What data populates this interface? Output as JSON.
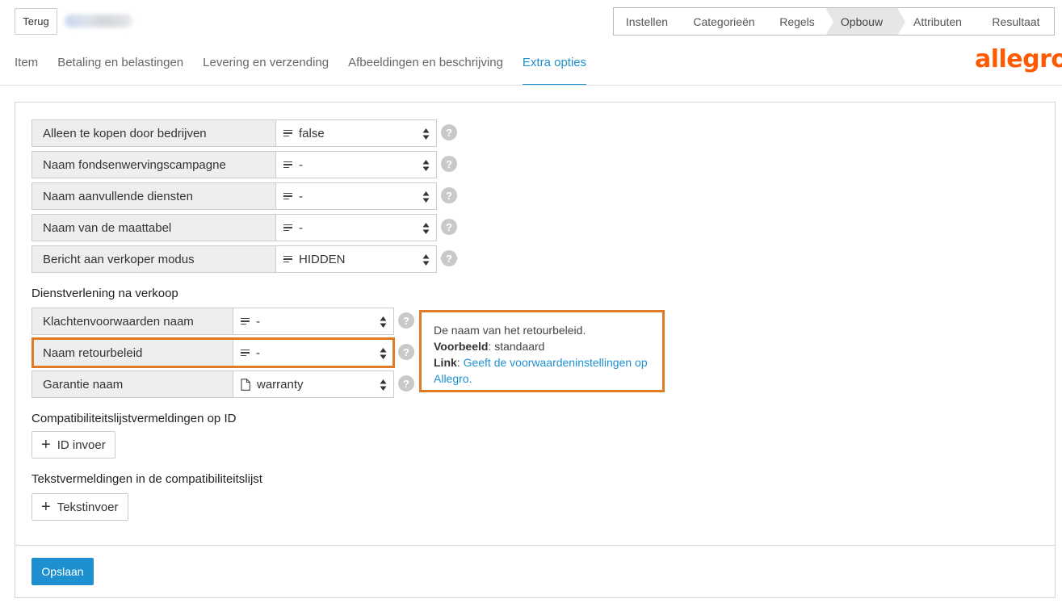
{
  "header": {
    "back_label": "Terug"
  },
  "steps": [
    {
      "label": "Instellen"
    },
    {
      "label": "Categorieën"
    },
    {
      "label": "Regels"
    },
    {
      "label": "Opbouw"
    },
    {
      "label": "Attributen"
    },
    {
      "label": "Resultaat"
    }
  ],
  "tabs": [
    {
      "label": "Item"
    },
    {
      "label": "Betaling en belastingen"
    },
    {
      "label": "Levering en verzending"
    },
    {
      "label": "Afbeeldingen en beschrijving"
    },
    {
      "label": "Extra opties"
    }
  ],
  "logo": "allegro",
  "fields": [
    {
      "label": "Alleen te kopen door bedrijven",
      "value": "false"
    },
    {
      "label": "Naam fondsenwervingscampagne",
      "value": "-"
    },
    {
      "label": "Naam aanvullende diensten",
      "value": "-"
    },
    {
      "label": "Naam van de maattabel",
      "value": "-"
    },
    {
      "label": "Bericht aan verkoper modus",
      "value": "HIDDEN"
    }
  ],
  "after_sales": {
    "title": "Dienstverlening na verkoop",
    "fields": [
      {
        "label": "Klachtenvoorwaarden naam",
        "value": "-"
      },
      {
        "label": "Naam retourbeleid",
        "value": "-"
      },
      {
        "label": "Garantie naam",
        "value": "warranty"
      }
    ]
  },
  "tooltip": {
    "description": "De naam van het retourbeleid.",
    "example_label": "Voorbeeld",
    "example_value": ": standaard",
    "link_label": "Link",
    "link_sep": ": ",
    "link_text": "Geeft de voorwaardeninstellingen op Allegro."
  },
  "compat_id": {
    "title": "Compatibiliteitslijstvermeldingen op ID",
    "button": "ID invoer"
  },
  "compat_text": {
    "title": "Tekstvermeldingen in de compatibiliteitslijst",
    "button": "Tekstinvoer"
  },
  "save_label": "Opslaan",
  "colors": {
    "accent": "#1e90d0",
    "highlight": "#e07b23",
    "brand": "#ff5a00"
  },
  "icons": [
    "lines-icon",
    "document-icon",
    "sort-arrows-icon",
    "help-icon",
    "plus-icon"
  ]
}
